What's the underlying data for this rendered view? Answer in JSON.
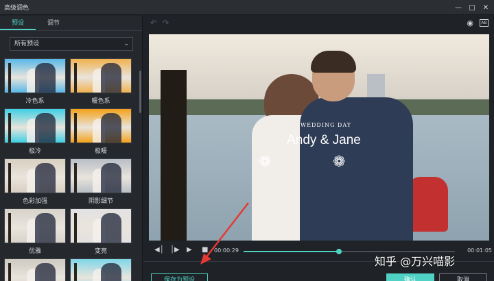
{
  "window": {
    "title": "高级调色"
  },
  "left": {
    "tabs": [
      {
        "label": "预设"
      },
      {
        "label": "调节"
      }
    ],
    "select": {
      "value": "所有预设"
    },
    "presets": [
      {
        "label": "冷色系",
        "tint": "#58b8e8"
      },
      {
        "label": "暖色系",
        "tint": "#f0b250"
      },
      {
        "label": "极冷",
        "tint": "#3fd0e4"
      },
      {
        "label": "极暖",
        "tint": "#f4a21a"
      },
      {
        "label": "色彩加强",
        "tint": "#d9cfc2"
      },
      {
        "label": "阴影细节",
        "tint": "#b8bfc6"
      },
      {
        "label": "优雅",
        "tint": "#d7d3cb"
      },
      {
        "label": "变亮",
        "tint": "#e2e2e2"
      },
      {
        "label": "",
        "tint": "#cfc9c0"
      },
      {
        "label": "",
        "tint": "#7fd6e8"
      }
    ]
  },
  "preview": {
    "overlay_top": "WEDDING DAY",
    "overlay_names": "Andy & Jane"
  },
  "playback": {
    "current_time": "00:00:29",
    "total_time": "00:01:05",
    "progress": 0.45
  },
  "buttons": {
    "save_preset": "保存为预设",
    "ok": "确认",
    "cancel": "取消"
  },
  "watermark": "知乎 @万兴喵影",
  "colors": {
    "accent": "#4fd2c3",
    "annotation": "#e53935"
  }
}
